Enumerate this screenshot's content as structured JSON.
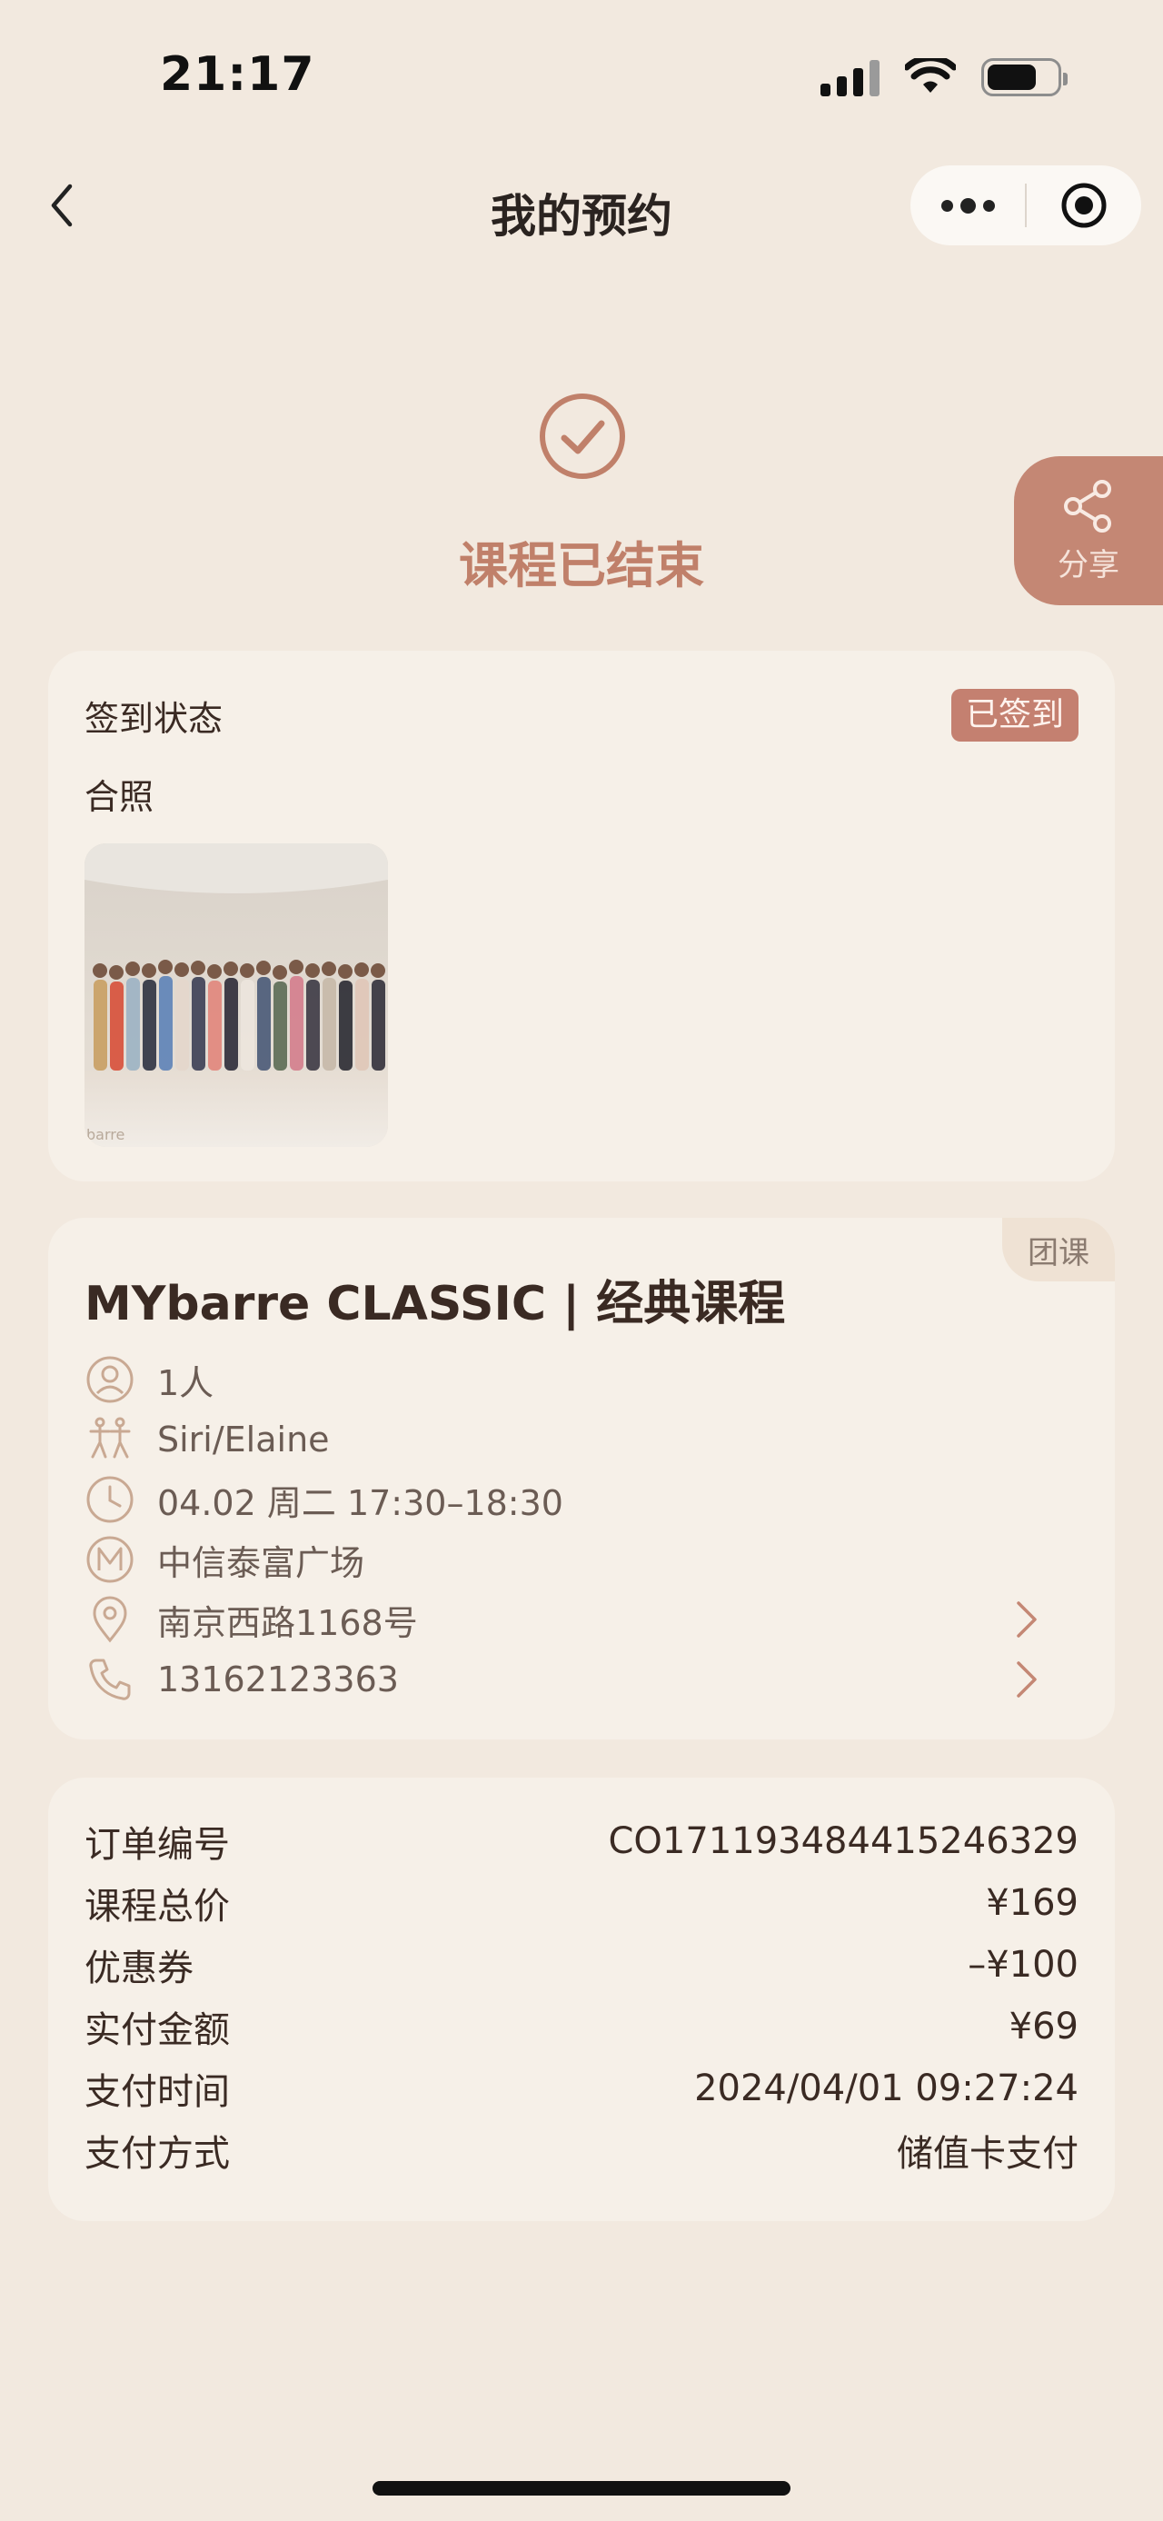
{
  "status_bar": {
    "time": "21:17"
  },
  "nav": {
    "title": "我的预约"
  },
  "status": {
    "text": "课程已结束"
  },
  "share": {
    "label": "分享"
  },
  "checkin": {
    "label": "签到状态",
    "badge": "已签到",
    "photo_label": "合照",
    "photo_watermark": "barre"
  },
  "course": {
    "tag": "团课",
    "title": "MYbarre CLASSIC | 经典课程",
    "people": "1人",
    "instructor": "Siri/Elaine",
    "datetime": "04.02 周二 17:30–18:30",
    "studio": "中信泰富广场",
    "address": "南京西路1168号",
    "phone": "13162123363"
  },
  "order": {
    "rows": [
      {
        "label": "订单编号",
        "value": "CO17119348441524632 9"
      },
      {
        "label": "课程总价",
        "value": "¥169"
      },
      {
        "label": "优惠券",
        "value": "–¥100"
      },
      {
        "label": "实付金额",
        "value": "¥69"
      },
      {
        "label": "支付时间",
        "value": "2024/04/01 09:27:24"
      },
      {
        "label": "支付方式",
        "value": "储值卡支付"
      }
    ]
  },
  "colors": {
    "background": "#F2E9DF",
    "card": "#F6F0E8",
    "accent": "#C48070",
    "icon": "#C9A993"
  }
}
